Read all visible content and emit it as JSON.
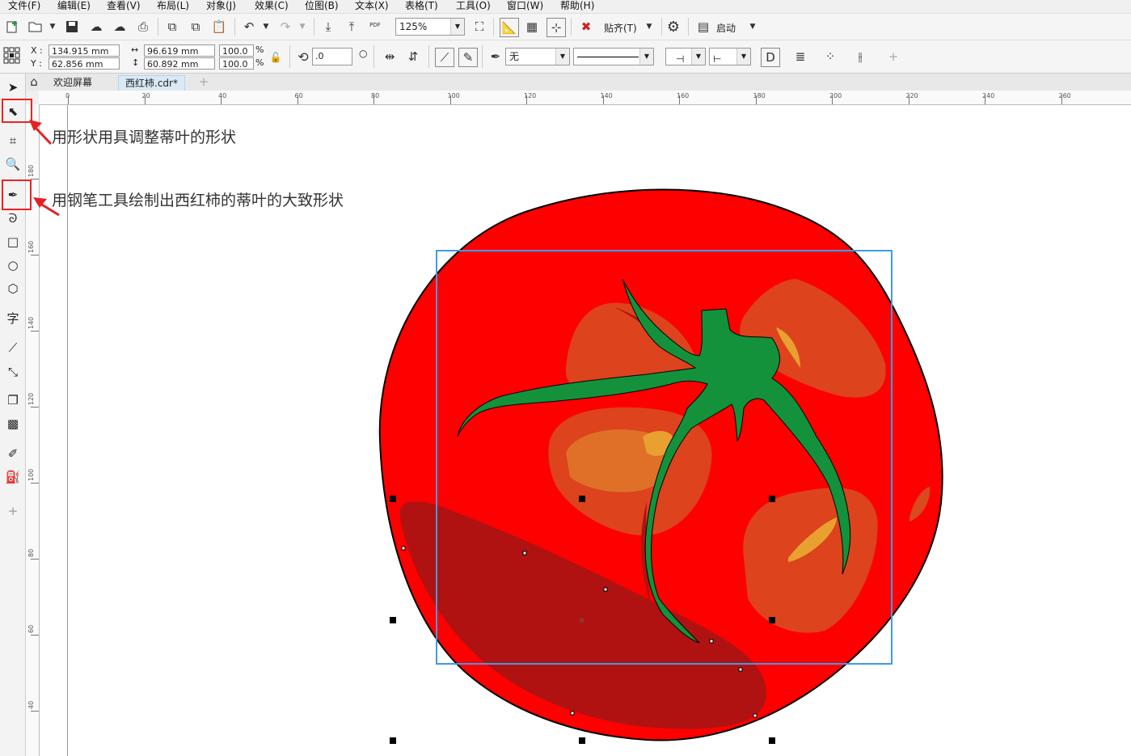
{
  "menu": [
    "文件(F)",
    "编辑(E)",
    "查看(V)",
    "布局(L)",
    "对象(J)",
    "效果(C)",
    "位图(B)",
    "文本(X)",
    "表格(T)",
    "工具(O)",
    "窗口(W)",
    "帮助(H)"
  ],
  "toolbar": {
    "zoom": "125%",
    "snap_label": "贴齐(T)",
    "launch_label": "启动",
    "pdf_label": "PDF"
  },
  "props": {
    "x_label": "X :",
    "y_label": "Y :",
    "x_value": "134.915 mm",
    "y_value": "62.856 mm",
    "w_value": "96.619 mm",
    "h_value": "60.892 mm",
    "scale_w": "100.0",
    "scale_h": "100.0",
    "pct": "%",
    "rotation": ".0",
    "fill": "无"
  },
  "tabs": {
    "welcome": "欢迎屏幕",
    "document": "西红柿.cdr*"
  },
  "ruler": {
    "h_labels": [
      "0",
      "20",
      "40",
      "60",
      "80",
      "100",
      "120",
      "140",
      "160",
      "180",
      "200",
      "220",
      "240",
      "260"
    ],
    "v_labels": [
      "180",
      "160",
      "140",
      "120",
      "100",
      "80",
      "60",
      "40"
    ]
  },
  "toolbox_glyphs": {
    "text_tool": "字",
    "add": "+"
  },
  "annotations": {
    "shape_tool_note": "用形状用具调整蒂叶的形状",
    "pen_tool_note": "用钢笔工具绘制出西红柿的蒂叶的大致形状"
  },
  "colors": {
    "tomato": "#ff0000",
    "shadow": "#b01010",
    "highlight": "#d94a1f",
    "leaf": "#13923b",
    "selection": "#3d9be9",
    "annotation_red": "#e22222"
  }
}
